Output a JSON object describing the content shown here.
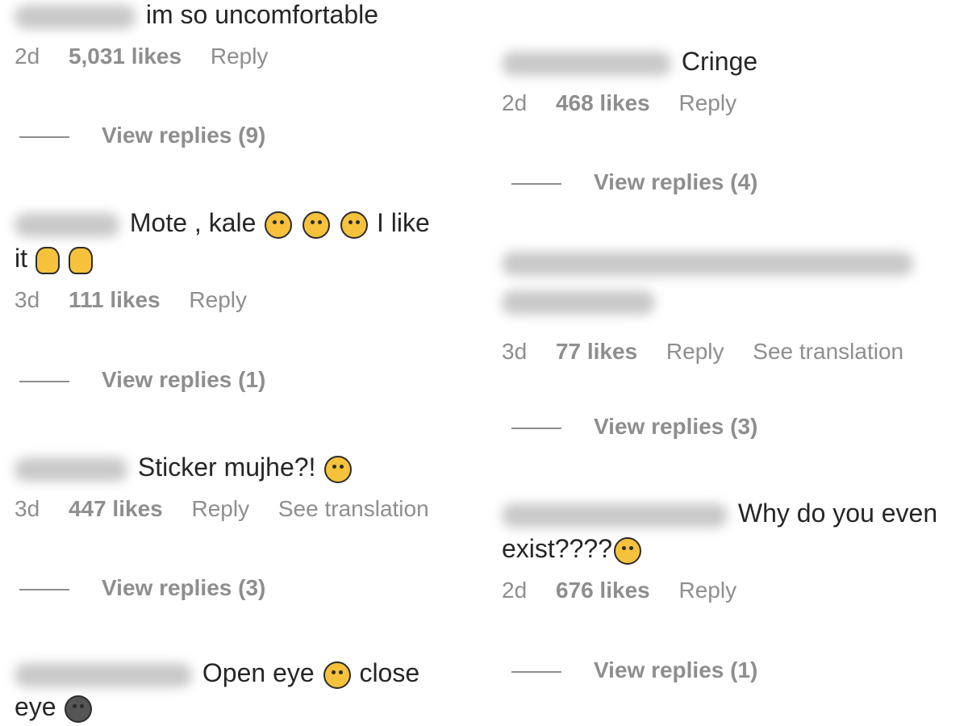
{
  "left": [
    {
      "text": "im so uncomfortable",
      "meta": {
        "age": "2d",
        "likes": "5,031 likes",
        "reply": "Reply"
      },
      "replies": "View replies (9)"
    },
    {
      "text": "Mote , kale",
      "text_after_emoji": "I like",
      "text_line2": "it",
      "meta": {
        "age": "3d",
        "likes": "111 likes",
        "reply": "Reply"
      },
      "replies": "View replies (1)"
    },
    {
      "text": "Sticker mujhe?!",
      "meta": {
        "age": "3d",
        "likes": "447 likes",
        "reply": "Reply",
        "translate": "See translation"
      },
      "replies": "View replies (3)"
    },
    {
      "text": "Open eye",
      "text_after_emoji": "close",
      "text_line2": "eye"
    }
  ],
  "right": [
    {
      "text": "Cringe",
      "meta": {
        "age": "2d",
        "likes": "468 likes",
        "reply": "Reply"
      },
      "replies": "View replies (4)"
    },
    {
      "meta": {
        "age": "3d",
        "likes": "77 likes",
        "reply": "Reply",
        "translate": "See translation"
      },
      "replies": "View replies (3)"
    },
    {
      "text": "Why do you even",
      "text_line2": "exist????",
      "meta": {
        "age": "2d",
        "likes": "676 likes",
        "reply": "Reply"
      },
      "replies": "View replies (1)"
    }
  ],
  "icons": {
    "laughing": "face-with-tears-of-joy-icon",
    "clapping": "clapping-hands-icon",
    "crying": "crying-face-icon",
    "grinning": "grinning-face-icon",
    "smiling": "slightly-smiling-face-icon"
  }
}
